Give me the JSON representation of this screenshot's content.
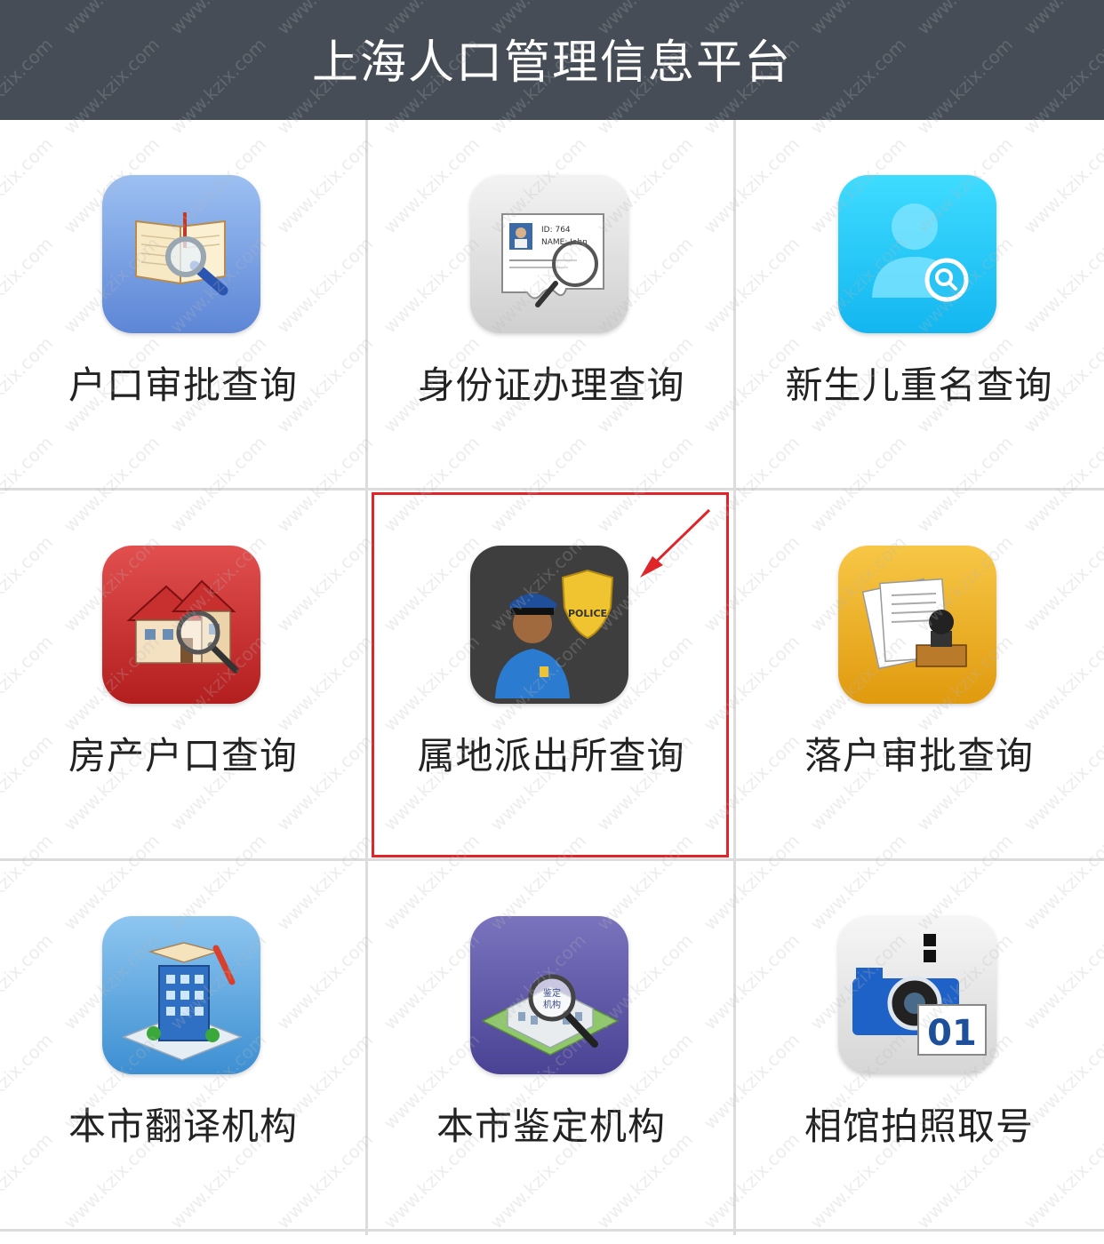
{
  "header": {
    "title": "上海人口管理信息平台"
  },
  "colors": {
    "header_bg": "#464d56",
    "highlight": "#e0252a",
    "divider": "#dcdcdc"
  },
  "tiles": [
    {
      "label": "户口审批查询",
      "icon": "book-magnifier-icon"
    },
    {
      "label": "身份证办理查询",
      "icon": "id-card-magnifier-icon"
    },
    {
      "label": "新生儿重名查询",
      "icon": "person-search-icon"
    },
    {
      "label": "房产户口查询",
      "icon": "house-magnifier-icon"
    },
    {
      "label": "属地派出所查询",
      "icon": "police-officer-badge-icon",
      "highlighted": true
    },
    {
      "label": "落户审批查询",
      "icon": "documents-stamp-icon"
    },
    {
      "label": "本市翻译机构",
      "icon": "building-book-pencil-icon"
    },
    {
      "label": "本市鉴定机构",
      "icon": "appraisal-building-magnifier-icon",
      "icon_text": "鉴定机构"
    },
    {
      "label": "相馆拍照取号",
      "icon": "camera-queue-number-icon",
      "icon_text": "01"
    }
  ],
  "police_icon_text": "POLICE",
  "id_card_text": [
    "ID: 764",
    "NAME: John"
  ],
  "watermark": "www.kzix.com"
}
